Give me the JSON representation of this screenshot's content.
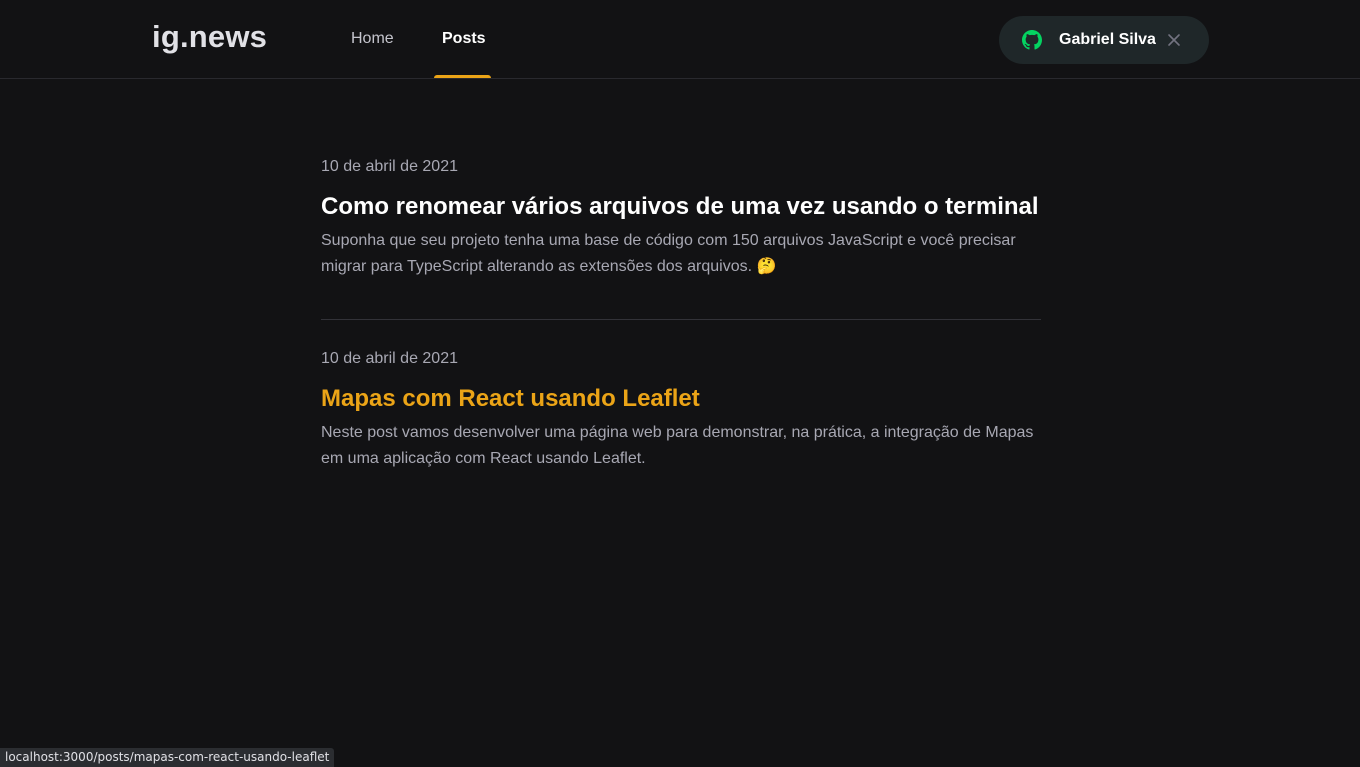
{
  "header": {
    "logo": "ig.news",
    "nav": [
      {
        "label": "Home",
        "active": false
      },
      {
        "label": "Posts",
        "active": true
      }
    ],
    "accent_color": "#eba417",
    "user": {
      "name": "Gabriel Silva",
      "icon": "github-icon",
      "icon_color": "#04d361",
      "action_icon": "close-icon"
    }
  },
  "posts": [
    {
      "date": "10 de abril de 2021",
      "title": "Como renomear vários arquivos de uma vez usando o terminal",
      "excerpt": "Suponha que seu projeto tenha uma base de código com 150 arquivos JavaScript e você precisar migrar para TypeScript alterando as extensões dos arquivos. 🤔"
    },
    {
      "date": "10 de abril de 2021",
      "title": "Mapas com React usando Leaflet",
      "excerpt": "Neste post vamos desenvolver uma página web para demonstrar, na prática, a integração de Mapas em uma aplicação com React usando Leaflet.",
      "hovered": true
    }
  ],
  "status_bar": {
    "url": "localhost:3000/posts/mapas-com-react-usando-leaflet"
  }
}
